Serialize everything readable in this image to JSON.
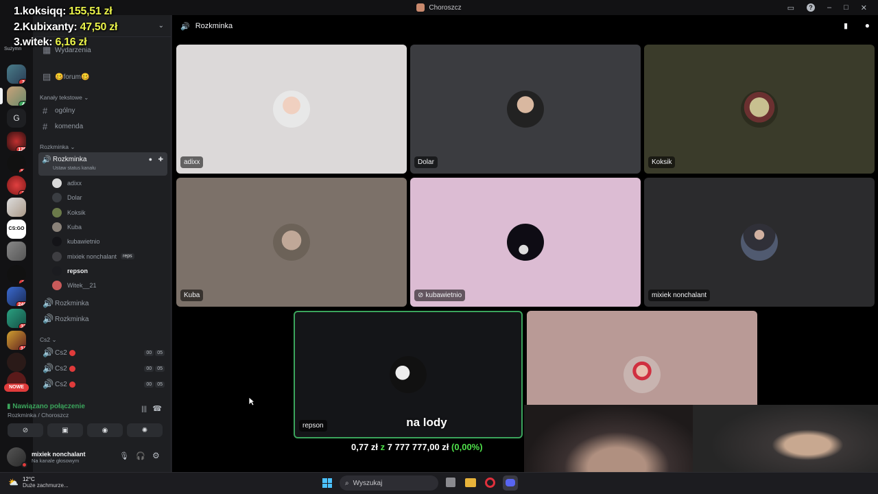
{
  "window": {
    "title": "Choroszcz"
  },
  "leaderboard": [
    {
      "rank": "1.",
      "name": "koksiqq:",
      "amount": "155,51 zł"
    },
    {
      "rank": "2.",
      "name": "Kubixanty:",
      "amount": "47,50 zł"
    },
    {
      "rank": "3.",
      "name": "witek:",
      "amount": "6,16 zł"
    }
  ],
  "rail": {
    "top_label": "Sużymn",
    "letter_server": "G",
    "badges": [
      "2",
      "4",
      "125",
      "13",
      "3",
      "1",
      "246",
      "33",
      "14"
    ],
    "new_label": "NOWE"
  },
  "sidebar": {
    "events_label": "Wydarzenia",
    "forum_label": "🥴forum🥴",
    "text_category": "Kanały tekstowe",
    "text_channels": [
      "ogólny",
      "komenda"
    ],
    "voice_category": "Rozkminka",
    "active_channel": "Rozkminka",
    "active_status": "Ustaw status kanału",
    "members": [
      {
        "name": "adixx",
        "color": "#d9d9d9",
        "tag": ""
      },
      {
        "name": "Dolar",
        "color": "#3a3d42",
        "tag": ""
      },
      {
        "name": "Koksik",
        "color": "#6b7a4a",
        "tag": ""
      },
      {
        "name": "Kuba",
        "color": "#8a8279",
        "tag": ""
      },
      {
        "name": "kubawietnio",
        "color": "#141418",
        "tag": ""
      },
      {
        "name": "mixiek nonchalant",
        "color": "#3e3e42",
        "tag": "reps"
      },
      {
        "name": "repson",
        "color": "#1b1c20",
        "tag": ""
      },
      {
        "name": "Witek__21",
        "color": "#c85a5a",
        "tag": ""
      }
    ],
    "other_voice": [
      "Rozkminka",
      "Rozkminka"
    ],
    "cs_category": "Cs2",
    "cs_channels": [
      {
        "name": "Cs2",
        "a": "00",
        "b": "05"
      },
      {
        "name": "Cs2",
        "a": "00",
        "b": "05"
      },
      {
        "name": "Cs2",
        "a": "00",
        "b": "05"
      }
    ]
  },
  "voice_panel": {
    "status": "Nawiązano połączenie",
    "location": "Rozkminka / Choroszcz"
  },
  "user_panel": {
    "name": "mixiek nonchalant",
    "status": "Na kanale głosowym"
  },
  "stage": {
    "channel": "Rozkminka",
    "tiles": [
      {
        "name": "adixx",
        "bg": "#dcd9d9"
      },
      {
        "name": "Dolar",
        "bg": "#3b3c40"
      },
      {
        "name": "Koksik",
        "bg": "#3a3b2a"
      },
      {
        "name": "Kuba",
        "bg": "#7c7169"
      },
      {
        "name": "kubawietnio",
        "bg": "#dcbcd3"
      },
      {
        "name": "mixiek nonchalant",
        "bg": "#2b2b2d"
      },
      {
        "name": "repson",
        "bg": "#141518"
      },
      {
        "name": "",
        "bg": "#b99a96"
      }
    ]
  },
  "donation": {
    "message": "na lody",
    "raised": "0,77 zł",
    "of": "z",
    "goal": "7 777 777,00 zł",
    "percent": "(0,00%)"
  },
  "taskbar": {
    "weather_temp": "12°C",
    "weather_desc": "Duże zachmurze...",
    "search_placeholder": "Wyszukaj"
  }
}
